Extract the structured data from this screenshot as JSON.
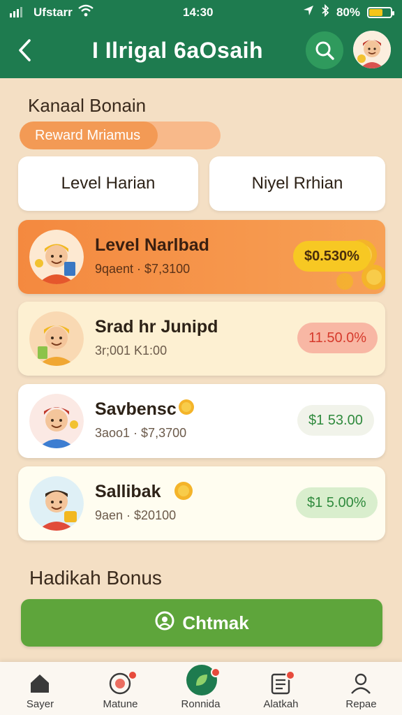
{
  "status_bar": {
    "carrier": "Ufstarr",
    "time": "14:30",
    "battery": "80%"
  },
  "header": {
    "title": "I Ilrigal 6aOsaih"
  },
  "section1": {
    "title": "Kanaal Bonain",
    "pill_label": "Reward Mriamus"
  },
  "tabs": [
    {
      "label": "Level Harian"
    },
    {
      "label": "Niyel Rrhian"
    }
  ],
  "cards": [
    {
      "name": "Level Narlbad",
      "sub": "9qaent · $7,3100",
      "value": "$0.530%"
    },
    {
      "name": "Srad hr Junipd",
      "sub": "3r;001 K1:00",
      "value": "11.50.0%"
    },
    {
      "name": "Savbensc",
      "sub": "3aoo1 · $7,3700",
      "value": "$1 53.00"
    },
    {
      "name": "Sallibak",
      "sub": "9aen · $20100",
      "value": "$1 5.00%"
    }
  ],
  "section2": {
    "title": "Hadikah Bonus",
    "claim_label": "Chtmak"
  },
  "bottom_nav": [
    {
      "label": "Sayer"
    },
    {
      "label": "Matune"
    },
    {
      "label": "Ronnida"
    },
    {
      "label": "Alatkah"
    },
    {
      "label": "Repae"
    }
  ],
  "colors": {
    "header_green": "#1e7b4f",
    "background": "#f4dfc4",
    "accent_orange": "#f39a55",
    "claim_green": "#5ea53b",
    "value_red": "#d63a2c",
    "value_green": "#2f8a3d"
  },
  "icons": {
    "back": "chevron-left-icon",
    "search": "search-icon",
    "profile": "user-avatar",
    "claim": "gift-icon",
    "nav": [
      "home-icon",
      "coin-icon",
      "leaf-icon",
      "list-icon",
      "user-icon"
    ]
  }
}
